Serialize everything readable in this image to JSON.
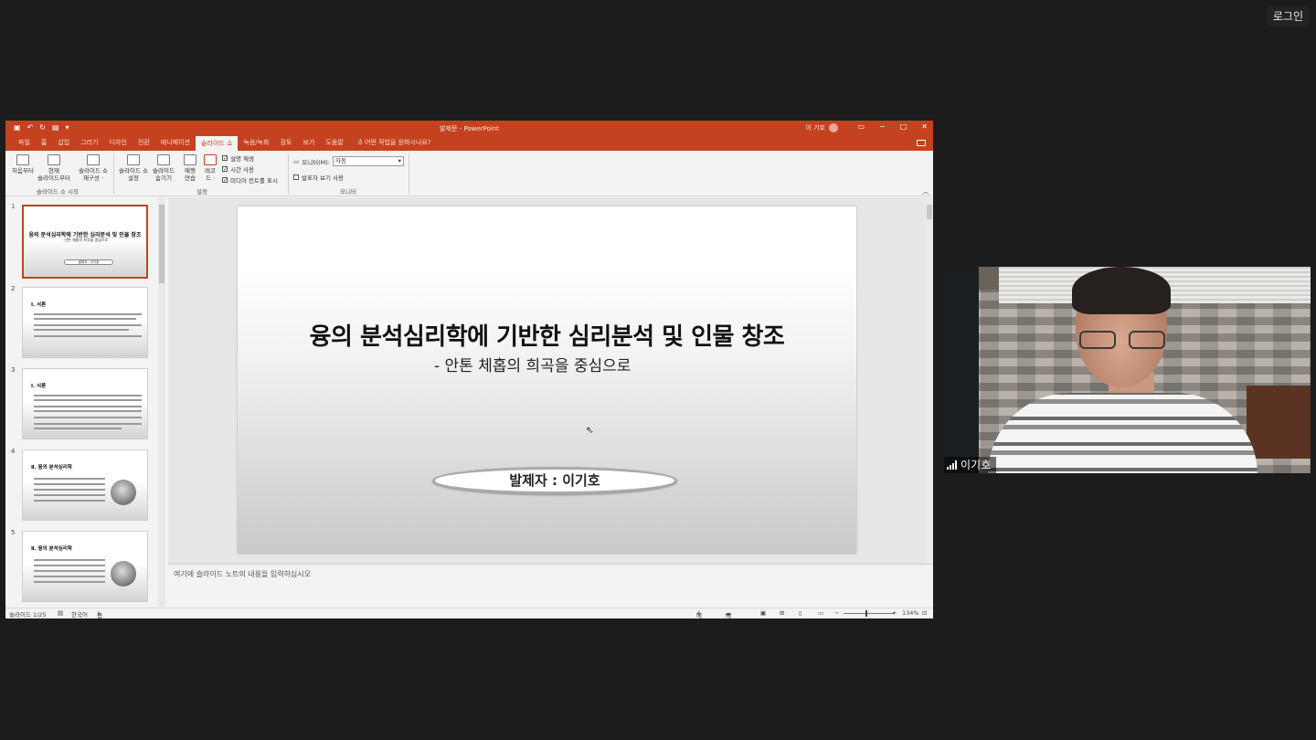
{
  "login_button": "로그인",
  "ppt": {
    "doc_title": "발제문 - PowerPoint",
    "user_name": "이 기호",
    "tabs": [
      "파일",
      "홈",
      "삽입",
      "그리기",
      "디자인",
      "전환",
      "애니메이션",
      "슬라이드 쇼",
      "녹음/녹화",
      "검토",
      "보기",
      "도움말"
    ],
    "active_tab_index": 7,
    "tell_me": "어떤 작업을 원하시나요?",
    "ribbon": {
      "from_beginning": "처음부터",
      "from_current_l1": "현재",
      "from_current_l2": "슬라이드부터",
      "custom_show_l1": "슬라이드 쇼",
      "custom_show_l2": "재구성 ·",
      "group_start": "슬라이드 쇼 시작",
      "setup_l1": "슬라이드 쇼",
      "setup_l2": "설정",
      "hide_l1": "슬라이드",
      "hide_l2": "숨기기",
      "rehearse_l1": "예행",
      "rehearse_l2": "연습",
      "record_l1": "레코",
      "record_l2": "드 ·",
      "play_narration": "설명 재생",
      "use_timings": "시간 사용",
      "show_media_controls": "미디어 컨트롤 표시",
      "group_setup": "설정",
      "monitor_label": "모니터(M):",
      "monitor_value": "자동",
      "presenter_view": "발표자 보기 사용",
      "group_monitor": "모니터"
    },
    "thumbnails": [
      {
        "num": "1",
        "title": "융의 분석심리학에 기반한 심리분석 및 인물 창조",
        "sub": "- 안톤 체홉의 희곡을 중심으로",
        "pill": "발제자 : 이기호"
      },
      {
        "num": "2",
        "head": "Ⅰ. 서론"
      },
      {
        "num": "3",
        "head": "Ⅰ. 서론"
      },
      {
        "num": "4",
        "head": "Ⅱ. 융의 분석심리학"
      },
      {
        "num": "5",
        "head": "Ⅱ. 융의 분석심리학"
      }
    ],
    "slide": {
      "title": "융의 분석심리학에 기반한 심리분석 및 인물 창조",
      "subtitle": "- 안톤 체홉의 희곡을 중심으로",
      "presenter": "발제자 : 이기호"
    },
    "notes_placeholder": "여기에 슬라이드 노트의 내용을 입력하십시오",
    "status": {
      "slide_counter": "슬라이드 1/25",
      "language": "한국어",
      "accessibility": "접근성: 조사 필요",
      "notes": "메모",
      "comments": "메모",
      "zoom": "134%"
    }
  },
  "video": {
    "participant_name": "이기호"
  }
}
